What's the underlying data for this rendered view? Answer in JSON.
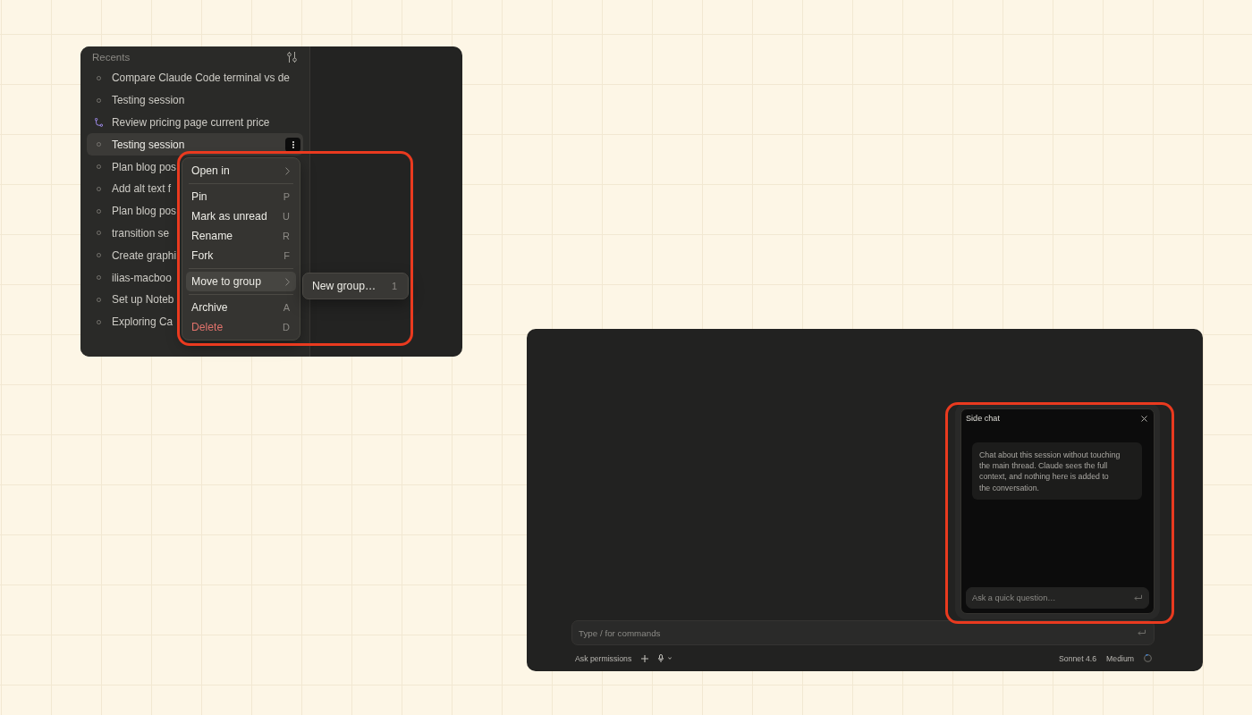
{
  "sidebar": {
    "header": "Recents",
    "items": [
      {
        "kind": "session",
        "title": "Compare Claude Code terminal vs de",
        "selected": false
      },
      {
        "kind": "session",
        "title": "Testing session",
        "selected": false
      },
      {
        "kind": "branch",
        "title": "Review pricing page current price",
        "selected": false
      },
      {
        "kind": "session",
        "title": "Testing session",
        "selected": true
      },
      {
        "kind": "session",
        "title": "Plan blog pos",
        "selected": false
      },
      {
        "kind": "session",
        "title": "Add alt text f",
        "selected": false
      },
      {
        "kind": "session",
        "title": "Plan blog pos",
        "selected": false
      },
      {
        "kind": "session",
        "title": "transition se",
        "selected": false
      },
      {
        "kind": "session",
        "title": "Create graphi",
        "selected": false
      },
      {
        "kind": "session",
        "title": "ilias-macboo",
        "selected": false
      },
      {
        "kind": "session",
        "title": "Set up Noteb",
        "selected": false
      },
      {
        "kind": "session",
        "title": "Exploring Ca",
        "selected": false
      }
    ]
  },
  "context_menu": {
    "highlighted": true,
    "groups": [
      {
        "items": [
          {
            "kind": "submenu",
            "label": "Open in",
            "selected": false
          }
        ]
      },
      {
        "items": [
          {
            "kind": "command",
            "label": "Pin",
            "shortcut": "P",
            "selected": false
          },
          {
            "kind": "command",
            "label": "Mark as unread",
            "shortcut": "U",
            "selected": false
          },
          {
            "kind": "command",
            "label": "Rename",
            "shortcut": "R",
            "selected": false
          },
          {
            "kind": "command",
            "label": "Fork",
            "shortcut": "F",
            "selected": false
          }
        ]
      },
      {
        "items": [
          {
            "kind": "submenu",
            "label": "Move to group",
            "selected": true
          }
        ]
      },
      {
        "items": [
          {
            "kind": "command",
            "label": "Archive",
            "shortcut": "A",
            "selected": false
          },
          {
            "kind": "destructive",
            "label": "Delete",
            "shortcut": "D",
            "selected": false
          }
        ]
      }
    ],
    "submenu": {
      "items": [
        {
          "label": "New group…",
          "shortcut": "1",
          "selected": false
        }
      ]
    }
  },
  "side_chat": {
    "highlighted": true,
    "title": "Side chat",
    "message": "Chat about this session without touching the main thread. Claude sees the full context, and nothing here is added to the conversation.",
    "input": {
      "placeholder": "Ask a quick question…"
    }
  },
  "composer": {
    "placeholder": "Type / for commands"
  },
  "footer": {
    "permission_mode": "Ask permissions",
    "model": "Sonnet 4.6",
    "effort": "Medium"
  }
}
